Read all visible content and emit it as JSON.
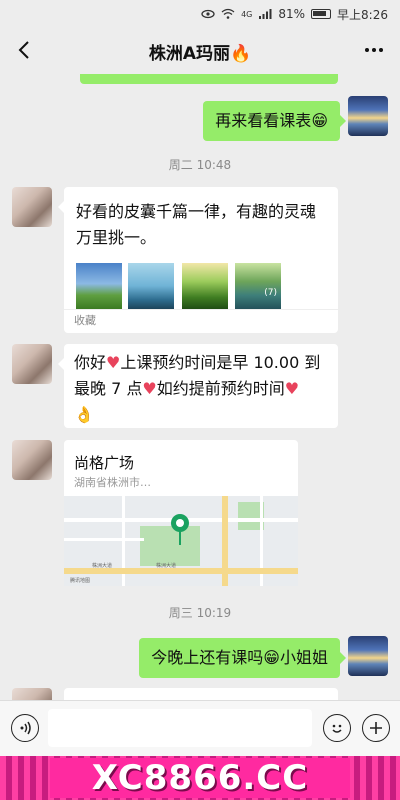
{
  "status_bar": {
    "signal": "4G",
    "battery": "81%",
    "time": "早上8:26"
  },
  "header": {
    "title": "株洲A玛丽",
    "title_emoji": "🔥"
  },
  "messages": {
    "m1": {
      "text": "再来看看课表",
      "emoji": "😁"
    },
    "time1": "周二 10:48",
    "m2": {
      "text": "好看的皮囊千篇一律，有趣的灵魂万里挑一。",
      "footer": "收藏",
      "more_count": "(7)"
    },
    "m3": {
      "text_a": "你好",
      "text_b": "上课预约时间是早 10.00 到最晚 7 点",
      "text_c": "如约提前预约时间"
    },
    "m4": {
      "title": "尚格广场",
      "address": "湖南省株洲市…",
      "map_labels": [
        "株洲大道",
        "株洲大道",
        "腾讯地图"
      ]
    },
    "time2": "周三 10:19",
    "m5": {
      "text_a": "今晚上还有课吗",
      "text_b": "小姐姐",
      "emoji": "😁"
    }
  },
  "banner": {
    "text": "XC8866.CC"
  },
  "colors": {
    "self_bubble": "#95ec69",
    "background": "#ededed",
    "banner": "#ff2aa0"
  }
}
